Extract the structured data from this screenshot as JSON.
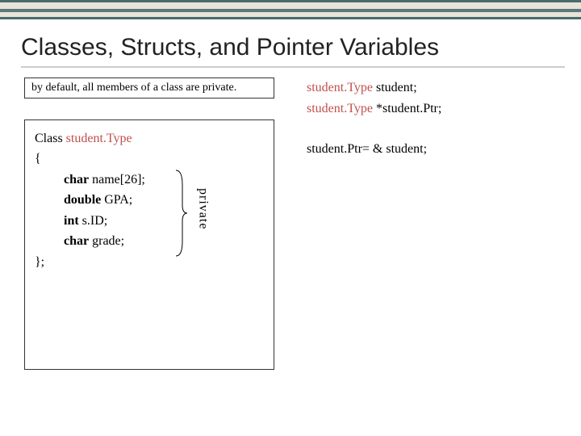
{
  "title": "Classes, Structs, and Pointer Variables",
  "note": "by default, all members of a class are private.",
  "class_def": {
    "keyword": "Class",
    "typename": "student.Type",
    "open": "{",
    "members": [
      {
        "type": "char",
        "rest": " name[26];"
      },
      {
        "type": "double",
        "rest": " GPA;"
      },
      {
        "type": "int",
        "rest": " s.ID;"
      },
      {
        "type": "char",
        "rest": " grade;"
      }
    ],
    "close": "};"
  },
  "private_label": "private",
  "decl": {
    "type1": "student.Type",
    "var1": " student;",
    "type2": "student.Type",
    "var2": " *student.Ptr;"
  },
  "assignment": "student.Ptr= & student;"
}
